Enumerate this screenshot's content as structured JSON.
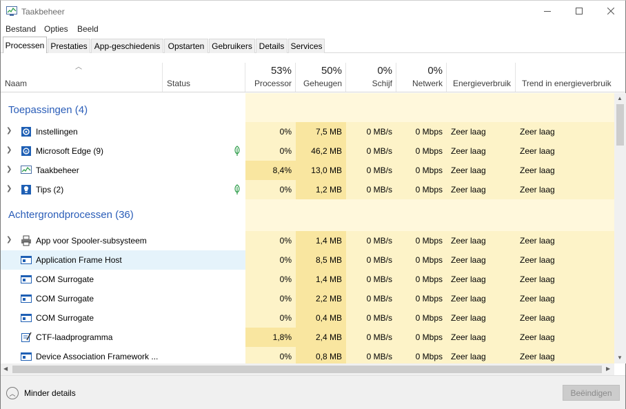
{
  "window": {
    "title": "Taakbeheer"
  },
  "menu": [
    "Bestand",
    "Opties",
    "Beeld"
  ],
  "tabs": [
    "Processen",
    "Prestaties",
    "App-geschiedenis",
    "Opstarten",
    "Gebruikers",
    "Details",
    "Services"
  ],
  "active_tab": "Processen",
  "columns": {
    "name": "Naam",
    "status": "Status",
    "cpu": {
      "pct": "53%",
      "label": "Processor"
    },
    "mem": {
      "pct": "50%",
      "label": "Geheugen"
    },
    "disk": {
      "pct": "0%",
      "label": "Schijf"
    },
    "net": {
      "pct": "0%",
      "label": "Netwerk"
    },
    "energy": "Energieverbruik",
    "energy_trend": "Trend in energieverbruik"
  },
  "groups": {
    "apps": {
      "title": "Toepassingen (4)",
      "rows": [
        {
          "name": "Instellingen",
          "icon": "gear-icon",
          "expandable": true,
          "suspended": false,
          "cpu": "0%",
          "mem": "7,5 MB",
          "disk": "0 MB/s",
          "net": "0 Mbps",
          "energy": "Zeer laag",
          "trend": "Zeer laag"
        },
        {
          "name": "Microsoft Edge (9)",
          "icon": "edge-icon",
          "expandable": true,
          "suspended": true,
          "cpu": "0%",
          "mem": "46,2 MB",
          "disk": "0 MB/s",
          "net": "0 Mbps",
          "energy": "Zeer laag",
          "trend": "Zeer laag"
        },
        {
          "name": "Taakbeheer",
          "icon": "taskmanager-icon",
          "expandable": true,
          "suspended": false,
          "cpu": "8,4%",
          "mem": "13,0 MB",
          "disk": "0 MB/s",
          "net": "0 Mbps",
          "energy": "Zeer laag",
          "trend": "Zeer laag"
        },
        {
          "name": "Tips (2)",
          "icon": "tips-icon",
          "expandable": true,
          "suspended": true,
          "cpu": "0%",
          "mem": "1,2 MB",
          "disk": "0 MB/s",
          "net": "0 Mbps",
          "energy": "Zeer laag",
          "trend": "Zeer laag"
        }
      ]
    },
    "background": {
      "title": "Achtergrondprocessen (36)",
      "rows": [
        {
          "name": "App voor Spooler-subsysteem",
          "icon": "printer-icon",
          "expandable": true,
          "suspended": false,
          "cpu": "0%",
          "mem": "1,4 MB",
          "disk": "0 MB/s",
          "net": "0 Mbps",
          "energy": "Zeer laag",
          "trend": "Zeer laag"
        },
        {
          "name": "Application Frame Host",
          "icon": "window-icon",
          "expandable": false,
          "suspended": false,
          "selected": true,
          "cpu": "0%",
          "mem": "8,5 MB",
          "disk": "0 MB/s",
          "net": "0 Mbps",
          "energy": "Zeer laag",
          "trend": "Zeer laag"
        },
        {
          "name": "COM Surrogate",
          "icon": "window-icon",
          "expandable": false,
          "suspended": false,
          "cpu": "0%",
          "mem": "1,4 MB",
          "disk": "0 MB/s",
          "net": "0 Mbps",
          "energy": "Zeer laag",
          "trend": "Zeer laag"
        },
        {
          "name": "COM Surrogate",
          "icon": "window-icon",
          "expandable": false,
          "suspended": false,
          "cpu": "0%",
          "mem": "2,2 MB",
          "disk": "0 MB/s",
          "net": "0 Mbps",
          "energy": "Zeer laag",
          "trend": "Zeer laag"
        },
        {
          "name": "COM Surrogate",
          "icon": "window-icon",
          "expandable": false,
          "suspended": false,
          "cpu": "0%",
          "mem": "0,4 MB",
          "disk": "0 MB/s",
          "net": "0 Mbps",
          "energy": "Zeer laag",
          "trend": "Zeer laag"
        },
        {
          "name": "CTF-laadprogramma",
          "icon": "ctf-icon",
          "expandable": false,
          "suspended": false,
          "cpu": "1,8%",
          "mem": "2,4 MB",
          "disk": "0 MB/s",
          "net": "0 Mbps",
          "energy": "Zeer laag",
          "trend": "Zeer laag"
        },
        {
          "name": "Device Association Framework ...",
          "icon": "window-icon",
          "expandable": false,
          "suspended": false,
          "cpu": "0%",
          "mem": "0,8 MB",
          "disk": "0 MB/s",
          "net": "0 Mbps",
          "energy": "Zeer laag",
          "trend": "Zeer laag"
        }
      ]
    }
  },
  "footer": {
    "less_details": "Minder details",
    "end_task": "Beëindigen"
  },
  "colors": {
    "heat_light": "#fff4c4",
    "heat_mid": "#f9eca8",
    "group_title": "#2a5db8",
    "selected_row": "#e5f3fb"
  }
}
